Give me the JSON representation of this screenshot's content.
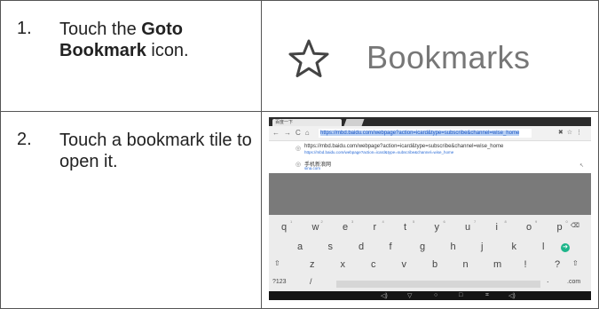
{
  "steps": [
    {
      "num": "1.",
      "text_before": "Touch the ",
      "bold": "Goto Bookmark",
      "text_after": " icon.",
      "image_label": "Bookmarks"
    },
    {
      "num": "2.",
      "text": "Touch a bookmark tile to open it."
    }
  ],
  "screenshot": {
    "tab_title": "百度一下",
    "url": "https://mbd.baidu.com/webpage?action=icard&type=subscribe&channel=wise_home",
    "suggestion_1_title": "https://mbd.baidu.com/webpage?action=icard&type=subscribe&channel=wise_home",
    "suggestion_1_url": "https://mbd.baidu.com/webpage?action=icard&type=subscribe&channel=wise_home",
    "suggestion_2_title": "手机新浪网",
    "suggestion_2_url": "sina.com",
    "keyboard_row1": [
      "q",
      "w",
      "e",
      "r",
      "t",
      "y",
      "u",
      "i",
      "o",
      "p"
    ],
    "keyboard_row1_hints": [
      "1",
      "2",
      "3",
      "4",
      "5",
      "6",
      "7",
      "8",
      "9",
      "0"
    ],
    "keyboard_row2": [
      "a",
      "s",
      "d",
      "f",
      "g",
      "h",
      "j",
      "k",
      "l"
    ],
    "keyboard_row3": [
      "z",
      "x",
      "c",
      "v",
      "b",
      "n",
      "m",
      "!",
      "?"
    ],
    "key_symbols": "?123",
    "key_slash": "/",
    "key_dotcom": ".com",
    "key_dot": "."
  },
  "colors": {
    "accent": "#1a56c4",
    "go_key": "#1eb58a"
  }
}
